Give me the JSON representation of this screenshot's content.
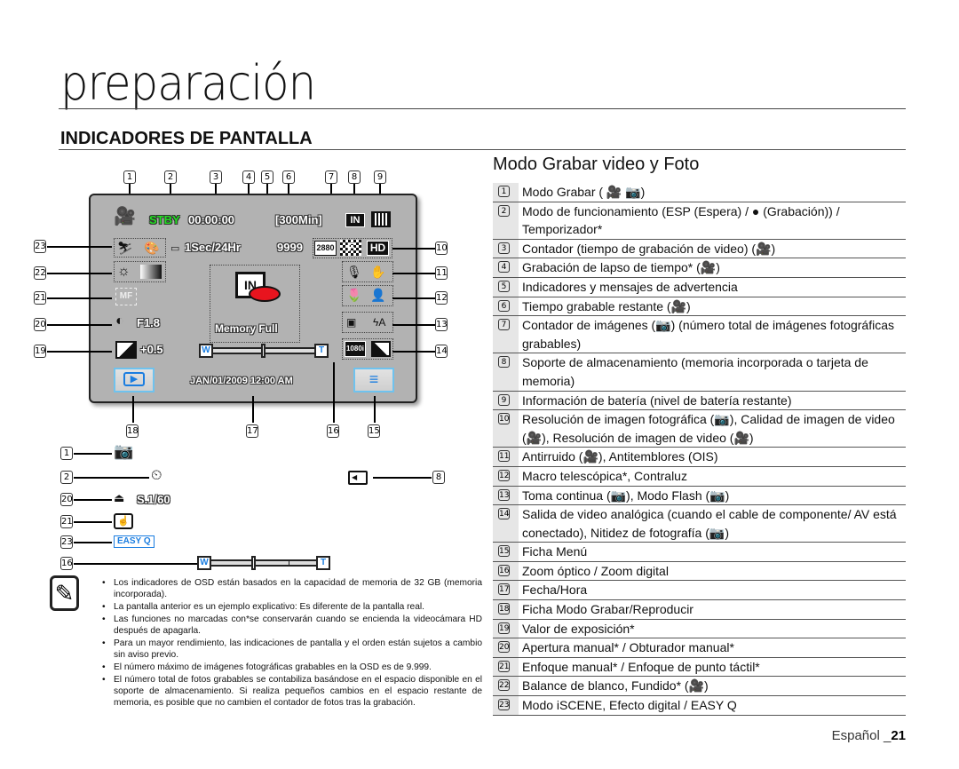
{
  "page": {
    "chapter_title": "preparación",
    "section_title": "INDICADORES DE PANTALLA",
    "right_title": "Modo Grabar video y Foto",
    "footer_lang": "Español _",
    "footer_page": "21"
  },
  "callouts": {
    "top": [
      "1",
      "2",
      "3",
      "4",
      "5",
      "6",
      "7",
      "8",
      "9"
    ],
    "left": [
      "23",
      "22",
      "21",
      "20",
      "19"
    ],
    "right": [
      "10",
      "11",
      "12",
      "13",
      "14"
    ],
    "bottom": [
      "18",
      "17",
      "16",
      "15"
    ],
    "photo_left": [
      "1",
      "2",
      "20",
      "21",
      "23",
      "16"
    ],
    "photo_right": [
      "8"
    ]
  },
  "lcd": {
    "mode_icon": "camcorder-icon",
    "status": "STBY",
    "counter": "00:00:00",
    "remaining_time": "[300Min]",
    "storage": "IN",
    "interval": "1Sec/24Hr",
    "photo_count": "9999",
    "photo_resolution": "2880",
    "quality": "F",
    "video_resolution": "HD",
    "warning_message": "Memory Full",
    "aperture": "F1.8",
    "exposure": "+0.5",
    "manual_focus": "MF",
    "zoom_w": "W",
    "zoom_t": "T",
    "datetime": "JAN/01/2009 12:00 AM",
    "analog_out": "1080i"
  },
  "photo_mode": {
    "shutter": "S.1/60",
    "easy_q": "EASY Q",
    "zoom_w": "W",
    "zoom_t": "T"
  },
  "notes": [
    "Los indicadores de OSD están basados en la capacidad de memoria de 32 GB (memoria incorporada).",
    "La pantalla anterior es un ejemplo explicativo: Es diferente de la pantalla real.",
    "Las funciones no marcadas con*se conservarán cuando se encienda la videocámara HD después de apagarla.",
    "Para un mayor rendimiento, las indicaciones de pantalla y el orden están sujetos a cambio sin aviso previo.",
    "El número máximo de imágenes fotográficas grabables en la OSD es de 9.999.",
    "El número total de fotos grabables se contabiliza basándose en el espacio disponible en el soporte de almacenamiento. Si realiza pequeños cambios en el espacio restante de memoria, es posible que no cambien el contador de fotos tras la grabación."
  ],
  "items": [
    {
      "n": "1",
      "text": "Modo Grabar ( 🎥 📷)"
    },
    {
      "n": "2",
      "text": "Modo de funcionamiento (ESP (Espera) / ● (Grabación)) / Temporizador*"
    },
    {
      "n": "3",
      "text": "Contador (tiempo de grabación de video) (🎥)"
    },
    {
      "n": "4",
      "text": "Grabación de lapso de tiempo* (🎥)"
    },
    {
      "n": "5",
      "text": "Indicadores y mensajes de advertencia"
    },
    {
      "n": "6",
      "text": "Tiempo grabable restante (🎥)"
    },
    {
      "n": "7",
      "text": "Contador de imágenes (📷) (número total de imágenes fotográficas grabables)"
    },
    {
      "n": "8",
      "text": "Soporte de almacenamiento (memoria incorporada o tarjeta de memoria)"
    },
    {
      "n": "9",
      "text": "Información de batería (nivel de batería restante)"
    },
    {
      "n": "10",
      "text": "Resolución de imagen fotográfica (📷), Calidad de imagen de video (🎥), Resolución de imagen de video (🎥)"
    },
    {
      "n": "11",
      "text": "Antirruido (🎥), Antitemblores (OIS)"
    },
    {
      "n": "12",
      "text": "Macro telescópica*, Contraluz"
    },
    {
      "n": "13",
      "text": "Toma continua (📷), Modo Flash (📷)"
    },
    {
      "n": "14",
      "text": "Salida de video analógica (cuando el cable de componente/ AV está conectado), Nitidez de fotografía (📷)"
    },
    {
      "n": "15",
      "text": "Ficha Menú"
    },
    {
      "n": "16",
      "text": "Zoom óptico / Zoom digital"
    },
    {
      "n": "17",
      "text": "Fecha/Hora"
    },
    {
      "n": "18",
      "text": "Ficha Modo Grabar/Reproducir"
    },
    {
      "n": "19",
      "text": "Valor de exposición*"
    },
    {
      "n": "20",
      "text": "Apertura manual* / Obturador manual*"
    },
    {
      "n": "21",
      "text": "Enfoque manual* / Enfoque de punto táctil*"
    },
    {
      "n": "22",
      "text": "Balance de blanco, Fundido* (🎥)"
    },
    {
      "n": "23",
      "text": "Modo iSCENE, Efecto digital / EASY Q"
    }
  ],
  "colors": {
    "lcd_bg": "#b2b2b2",
    "status_green": "#22dd22",
    "accent_blue": "#1a7de0",
    "memory_red": "#e8141e"
  }
}
